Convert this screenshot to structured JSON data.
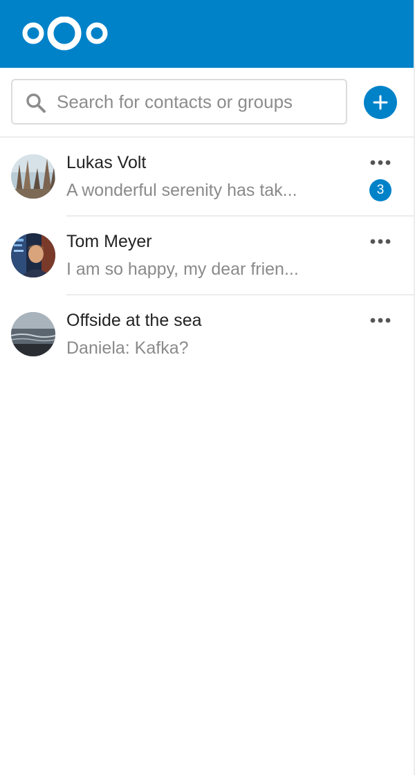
{
  "app": {
    "brand_color": "#0082c9",
    "logo_icon": "nextcloud-logo"
  },
  "search": {
    "placeholder": "Search for contacts or groups",
    "value": "",
    "icon": "search-icon"
  },
  "add_button": {
    "icon": "plus-icon"
  },
  "conversations": [
    {
      "name": "Lukas Volt",
      "preview": "A wonderful serenity has tak...",
      "unread": "3",
      "avatar": "forest-photo"
    },
    {
      "name": "Tom Meyer",
      "preview": "I am so happy, my dear frien...",
      "unread": "",
      "avatar": "portrait-photo"
    },
    {
      "name": "Offside at the sea",
      "preview": "Daniela: Kafka?",
      "unread": "",
      "avatar": "sea-photo"
    }
  ]
}
